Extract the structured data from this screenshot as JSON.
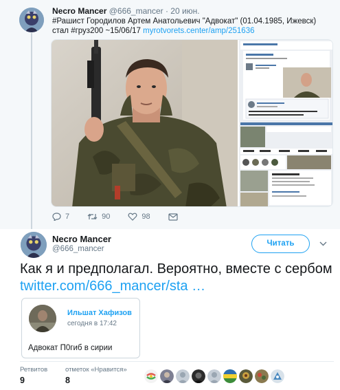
{
  "parent_tweet": {
    "author_name": "Necro Mancer",
    "author_handle": "@666_mancer",
    "separator": "·",
    "date": "20 июн.",
    "text_main": "#Рашист Городилов Артем Анатольевич \"Адвокат\" (01.04.1985, Ижевск) стал #груз200 ~15/06/17 ",
    "text_link": "myrotvorets.center/amp/251636",
    "actions": {
      "replies": "7",
      "retweets": "90",
      "likes": "98"
    },
    "icons": [
      "reply-icon",
      "retweet-icon",
      "like-icon",
      "dm-icon"
    ]
  },
  "main_tweet": {
    "author_name": "Necro Mancer",
    "author_handle": "@666_mancer",
    "follow_label": "Читать",
    "text_main": "Как я и предполагал. Вероятно, вместе с сербом ",
    "text_link": "twitter.com/666_mancer/sta …",
    "quoted_card": {
      "name": "Ильшат Хафизов",
      "time": "сегодня в 17:42",
      "text": "Адвокат П0гиб в сирии"
    },
    "stats": {
      "retweets_label": "Ретвитов",
      "retweets_value": "9",
      "likes_label": "отметок «Нравится»",
      "likes_value": "8"
    },
    "liker_count": 9
  },
  "colors": {
    "accent": "#1da1f2",
    "text": "#14171a",
    "muted": "#657786",
    "parent_bg": "#f5f8fa"
  }
}
